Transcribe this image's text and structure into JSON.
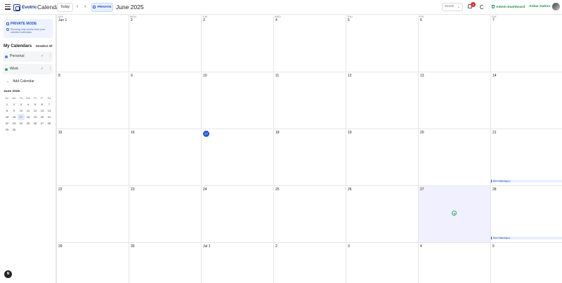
{
  "header": {
    "logo_text": "Evotric",
    "app_title": "Calendar",
    "today_label": "Today",
    "prev_icon": "chevron-left-icon",
    "next_icon": "chevron-right-icon",
    "private_label": "PRIVATE",
    "month_label": "June 2025",
    "view_select": "Month",
    "notification_count": "4",
    "admin_label": "Admin Dashboard",
    "user_name": "Anbar Kabiro"
  },
  "sidebar": {
    "private_mode_title": "PRIVATE MODE",
    "private_mode_desc": "Showing only events from your selected calendars",
    "my_calendars_title": "My Calendars",
    "deselect_label": "Deselect All",
    "calendars": [
      {
        "label": "Personal",
        "color": "#4a7bd8"
      },
      {
        "label": "Work",
        "color": "#3aa56a"
      }
    ],
    "add_calendar_label": "Add Calendar",
    "mini_month_title": "June 2025",
    "mini_weekdays": [
      "Su",
      "Mo",
      "Tu",
      "We",
      "Th",
      "Fr",
      "Sa"
    ],
    "mini_weeks": [
      [
        "1",
        "2",
        "3",
        "4",
        "5",
        "6",
        "7"
      ],
      [
        "8",
        "9",
        "10",
        "11",
        "12",
        "13",
        "14"
      ],
      [
        "15",
        "16",
        "17",
        "18",
        "19",
        "20",
        "21"
      ],
      [
        "22",
        "23",
        "24",
        "25",
        "26",
        "27",
        "28"
      ],
      [
        "29",
        "30",
        "",
        "",
        "",
        "",
        ""
      ]
    ],
    "help_label": "N"
  },
  "calendar": {
    "weekdays": [
      "SUN",
      "MON",
      "TUE",
      "WED",
      "THU",
      "FRI",
      "SAT"
    ],
    "weeks": [
      [
        "Jun 1",
        "2",
        "3",
        "4",
        "5",
        "6",
        "7"
      ],
      [
        "8",
        "9",
        "10",
        "11",
        "12",
        "13",
        "14"
      ],
      [
        "15",
        "16",
        "17",
        "18",
        "19",
        "20",
        "21"
      ],
      [
        "22",
        "23",
        "24",
        "25",
        "26",
        "27",
        "28"
      ],
      [
        "29",
        "30",
        "Jul 1",
        "2",
        "3",
        "4",
        "5"
      ]
    ],
    "today_label": "17",
    "events": [
      {
        "label": "Rent Saturdays ▸"
      },
      {
        "label": "Rent Saturdays ▸"
      }
    ]
  }
}
